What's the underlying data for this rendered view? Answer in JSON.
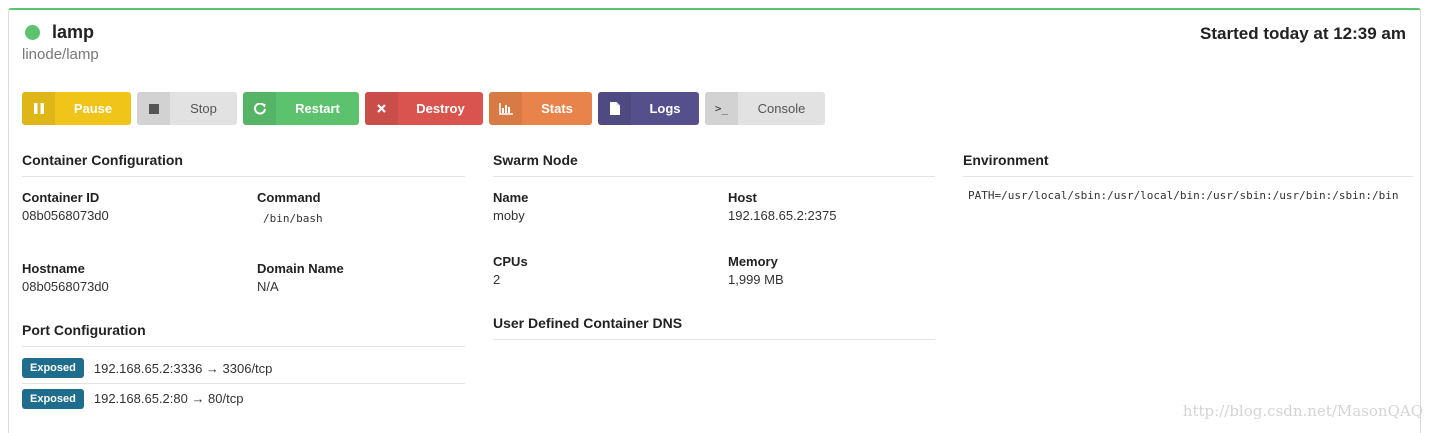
{
  "header": {
    "name": "lamp",
    "image": "linode/lamp",
    "started": "Started today at 12:39 am",
    "status_color": "#5cc26e"
  },
  "toolbar": {
    "pause": "Pause",
    "stop": "Stop",
    "restart": "Restart",
    "destroy": "Destroy",
    "stats": "Stats",
    "logs": "Logs",
    "console": "Console",
    "console_icon": ">_"
  },
  "container_config": {
    "heading": "Container Configuration",
    "container_id_label": "Container ID",
    "container_id": "08b0568073d0",
    "command_label": "Command",
    "command": "/bin/bash",
    "hostname_label": "Hostname",
    "hostname": "08b0568073d0",
    "domain_label": "Domain Name",
    "domain": "N/A"
  },
  "port_config": {
    "heading": "Port Configuration",
    "ports": [
      {
        "badge": "Exposed",
        "mapping": "192.168.65.2:3336 → 3306/tcp"
      },
      {
        "badge": "Exposed",
        "mapping": "192.168.65.2:80 → 80/tcp"
      }
    ]
  },
  "swarm_node": {
    "heading": "Swarm Node",
    "name_label": "Name",
    "name": "moby",
    "host_label": "Host",
    "host": "192.168.65.2:2375",
    "cpus_label": "CPUs",
    "cpus": "2",
    "memory_label": "Memory",
    "memory": "1,999 MB"
  },
  "dns": {
    "heading": "User Defined Container DNS"
  },
  "environment": {
    "heading": "Environment",
    "path": "PATH=/usr/local/sbin:/usr/local/bin:/usr/sbin:/usr/bin:/sbin:/bin"
  },
  "watermark": "http://blog.csdn.net/MasonQAQ"
}
